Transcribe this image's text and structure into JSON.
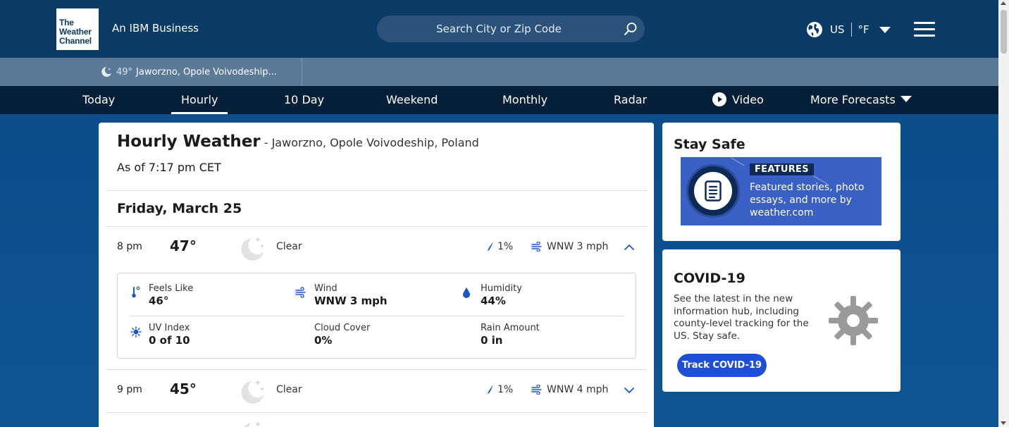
{
  "header": {
    "logo_lines": [
      "The",
      "Weather",
      "Channel"
    ],
    "tagline": "An IBM Business",
    "search_placeholder": "Search City or Zip Code",
    "locale_country": "US",
    "locale_unit": "°F",
    "icons": [
      "globe-icon",
      "search-icon",
      "chevron-down-icon",
      "menu-icon"
    ]
  },
  "recent": {
    "temp": "49°",
    "location": "Jaworzno, Opole Voivodeship..."
  },
  "nav": {
    "items": [
      "Today",
      "Hourly",
      "10 Day",
      "Weekend",
      "Monthly",
      "Radar",
      "Video",
      "More Forecasts"
    ],
    "active": "Hourly"
  },
  "main": {
    "title": "Hourly Weather",
    "location": " - Jaworzno, Opole Voivodeship, Poland",
    "as_of": "As of 7:17 pm CET",
    "day": "Friday, March 25",
    "rows": [
      {
        "time": "8 pm",
        "temp": "47°",
        "condition": "Clear",
        "precip": "1%",
        "wind": "WNW 3 mph",
        "expanded": true
      },
      {
        "time": "9 pm",
        "temp": "45°",
        "condition": "Clear",
        "precip": "1%",
        "wind": "WNW 4 mph",
        "expanded": false
      }
    ],
    "details": {
      "feels_like_label": "Feels Like",
      "feels_like": "46°",
      "wind_label": "Wind",
      "wind": "WNW 3 mph",
      "humidity_label": "Humidity",
      "humidity": "44%",
      "uv_label": "UV Index",
      "uv": "0 of 10",
      "cloud_label": "Cloud Cover",
      "cloud": "0%",
      "rain_label": "Rain Amount",
      "rain": "0 in"
    }
  },
  "sidebar": {
    "stay_safe_title": "Stay Safe",
    "feature_tag": "FEATURES",
    "feature_text": "Featured stories, photo essays, and more by weather.com",
    "covid_title": "COVID-19",
    "covid_text": "See the latest in the new information hub, including county-level tracking for the US. Stay safe.",
    "covid_button": "Track COVID-19"
  },
  "colors": {
    "header_bg": "#0a3a66",
    "nav_bg": "#051f38",
    "accent_blue": "#1f4fd6",
    "precip_blue": "#1a56c7"
  }
}
